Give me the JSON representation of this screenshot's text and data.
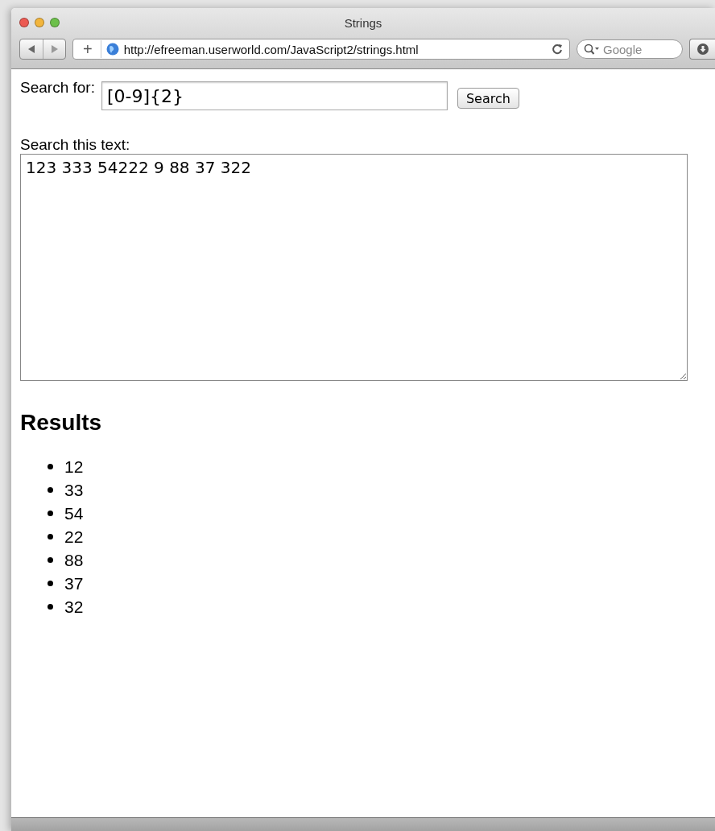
{
  "window": {
    "title": "Strings"
  },
  "toolbar": {
    "add_label": "+",
    "url": "http://efreeman.userworld.com/JavaScript2/strings.html",
    "search_placeholder": "Google"
  },
  "form": {
    "search_label": "Search for:",
    "search_value": "[0-9]{2}",
    "search_button": "Search",
    "text_label": "Search this text:",
    "text_value": "123 333 54222 9 88 37 322"
  },
  "results": {
    "heading": "Results",
    "items": [
      "12",
      "33",
      "54",
      "22",
      "88",
      "37",
      "32"
    ]
  }
}
